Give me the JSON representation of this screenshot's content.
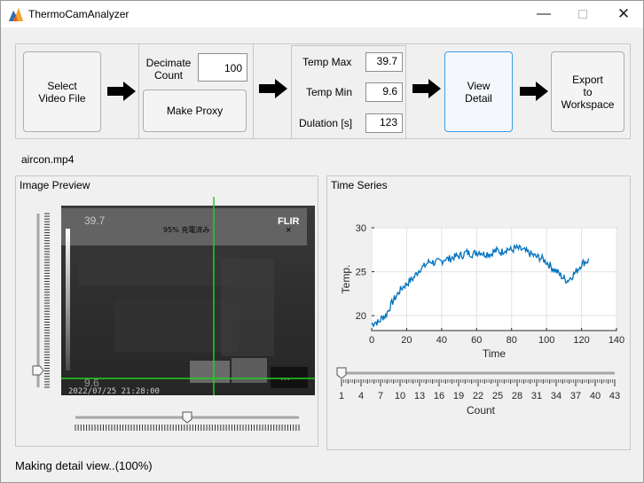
{
  "window": {
    "title": "ThermoCamAnalyzer"
  },
  "toolbar": {
    "select_video_label_1": "Select",
    "select_video_label_2": "Video File",
    "decimate_label_1": "Decimate",
    "decimate_label_2": "Count",
    "decimate_value": "100",
    "make_proxy_label": "Make Proxy",
    "temp_max_label": "Temp Max",
    "temp_max_value": "39.7",
    "temp_min_label": "Temp Min",
    "temp_min_value": "9.6",
    "duration_label": "Dulation [s]",
    "duration_value": "123",
    "view_detail_label_1": "View",
    "view_detail_label_2": "Detail",
    "export_label_1": "Export",
    "export_label_2": "to",
    "export_label_3": "Workspace"
  },
  "file": {
    "name": "aircon.mp4"
  },
  "preview": {
    "title": "Image Preview",
    "overlay_max": "39.7",
    "overlay_min": "9.6",
    "overlay_charge": "95% 充電済み",
    "overlay_brand": "FLIR",
    "overlay_timestamp": "2022/07/25 21:28:00",
    "overlay_close": "×",
    "overlay_menu": "···",
    "vertical_slider_value": 0.0,
    "horizontal_slider_value": 0.5
  },
  "timeseries": {
    "title": "Time Series",
    "count_label": "Count",
    "count_slider_value": 0.0
  },
  "chart_data": {
    "type": "line",
    "title": "",
    "xlabel": "Time",
    "ylabel": "Temp.",
    "xlim": [
      0,
      140
    ],
    "ylim": [
      18.3,
      30
    ],
    "xticks": [
      0,
      20,
      40,
      60,
      80,
      100,
      120,
      140
    ],
    "yticks": [
      20,
      25,
      30
    ],
    "grid": true,
    "color": "#0072bd",
    "series": [
      {
        "x": [
          0,
          2,
          4,
          6,
          8,
          10,
          12,
          14,
          16,
          18,
          20,
          22,
          24,
          26,
          28,
          30,
          32,
          34,
          36,
          38,
          40,
          42,
          44,
          46,
          48,
          50,
          52,
          54,
          56,
          58,
          60,
          62,
          64,
          66,
          68,
          70,
          72,
          74,
          76,
          78,
          80,
          82,
          84,
          86,
          88,
          90,
          92,
          94,
          96,
          98,
          100,
          102,
          104,
          106,
          108,
          110,
          112,
          114,
          116,
          118,
          120,
          122,
          124
        ],
        "y": [
          19.0,
          19.3,
          19.2,
          19.8,
          20.0,
          20.8,
          21.6,
          22.2,
          22.8,
          23.3,
          23.6,
          24.0,
          24.3,
          24.9,
          25.4,
          25.6,
          26.0,
          26.2,
          26.0,
          26.1,
          26.2,
          26.5,
          26.4,
          26.6,
          26.7,
          26.8,
          26.9,
          27.2,
          27.1,
          27.0,
          27.2,
          27.3,
          27.0,
          27.1,
          27.0,
          27.3,
          27.4,
          27.2,
          27.5,
          27.6,
          27.4,
          27.7,
          27.6,
          27.5,
          27.3,
          27.1,
          26.9,
          26.7,
          26.6,
          26.4,
          26.1,
          25.7,
          25.3,
          25.0,
          24.6,
          24.2,
          24.0,
          24.4,
          24.8,
          25.3,
          25.9,
          26.1,
          26.3
        ]
      }
    ],
    "slider": {
      "min": 1,
      "max": 43,
      "labeled_ticks": [
        1,
        4,
        7,
        10,
        13,
        16,
        19,
        22,
        25,
        28,
        31,
        34,
        37,
        40,
        43
      ]
    }
  },
  "status": {
    "text": "Making detail view..(100%)"
  }
}
